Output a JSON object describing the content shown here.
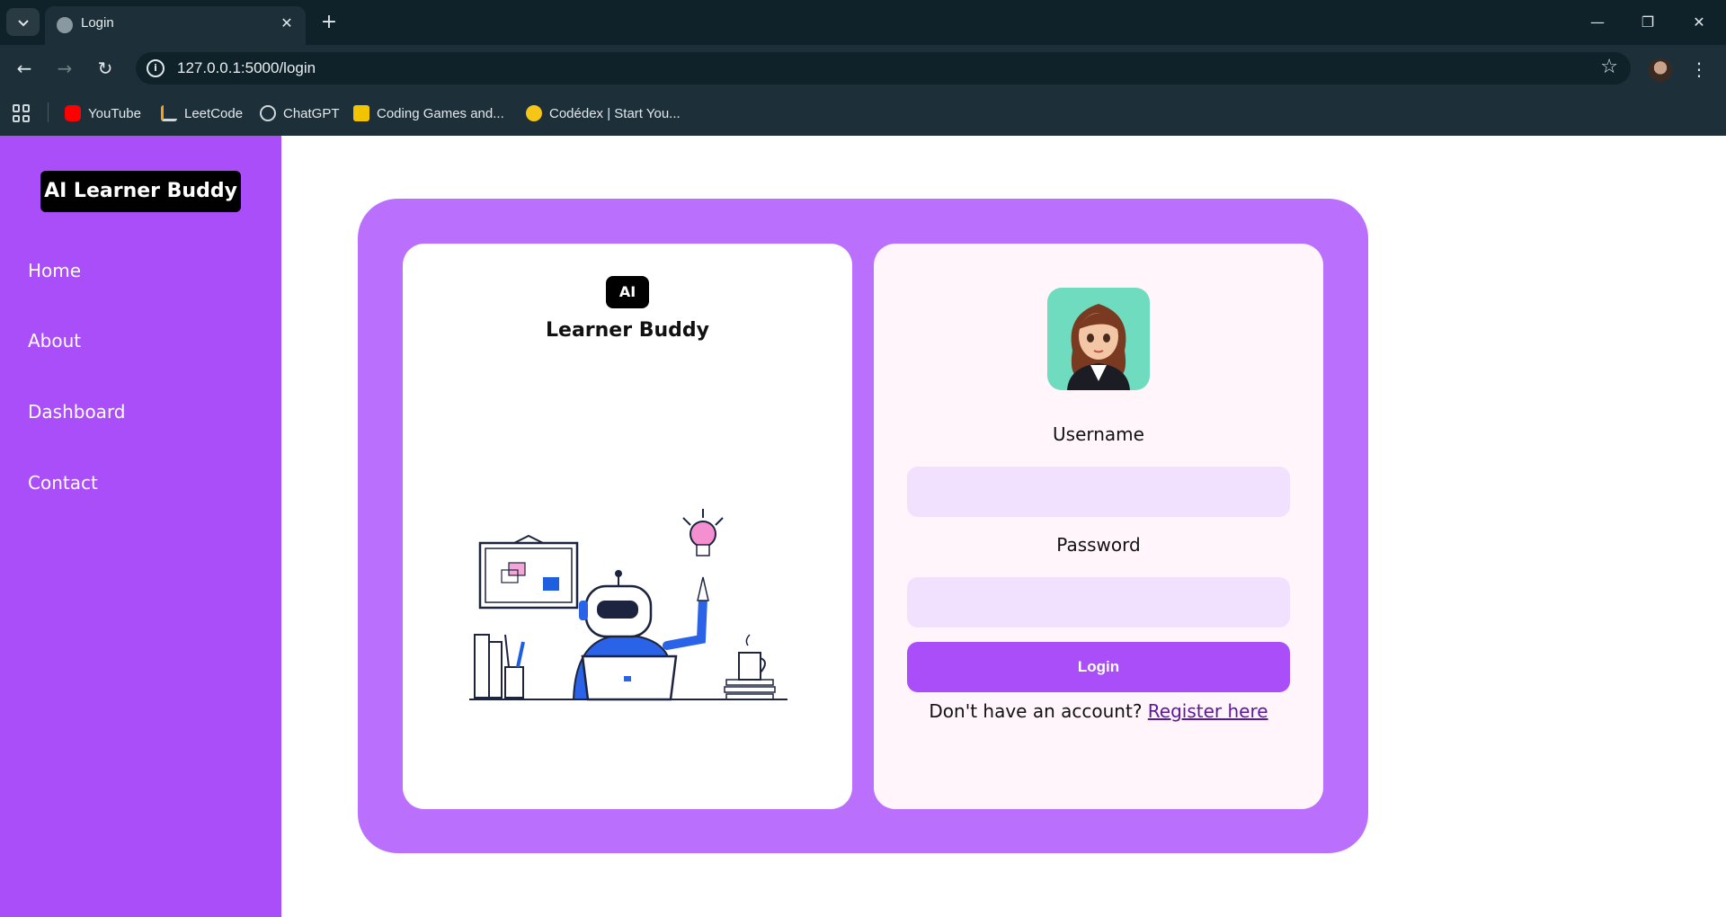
{
  "browser": {
    "tab_title": "Login",
    "url": "127.0.0.1:5000/login",
    "bookmarks": [
      {
        "label": "YouTube",
        "icon": "youtube-icon",
        "color": "#ff0000"
      },
      {
        "label": "LeetCode",
        "icon": "leetcode-icon",
        "color": "#f89f1b"
      },
      {
        "label": "ChatGPT",
        "icon": "chatgpt-icon",
        "color": "#cfd8dc"
      },
      {
        "label": "Coding Games and...",
        "icon": "codingame-icon",
        "color": "#f2c400"
      },
      {
        "label": "Codédex | Start You...",
        "icon": "codedex-icon",
        "color": "#f5c518"
      }
    ]
  },
  "sidebar": {
    "brand": "AI Learner Buddy",
    "links": [
      "Home",
      "About",
      "Dashboard",
      "Contact"
    ]
  },
  "left_panel": {
    "badge": "AI",
    "title": "Learner Buddy"
  },
  "login_form": {
    "username_label": "Username",
    "password_label": "Password",
    "login_button": "Login",
    "register_prompt": "Don't have an account?",
    "register_link": "Register here"
  },
  "colors": {
    "sidebar": "#a94ef8",
    "card": "#ba6ffd",
    "input": "#f1e1ff",
    "button": "#a94ef8"
  }
}
